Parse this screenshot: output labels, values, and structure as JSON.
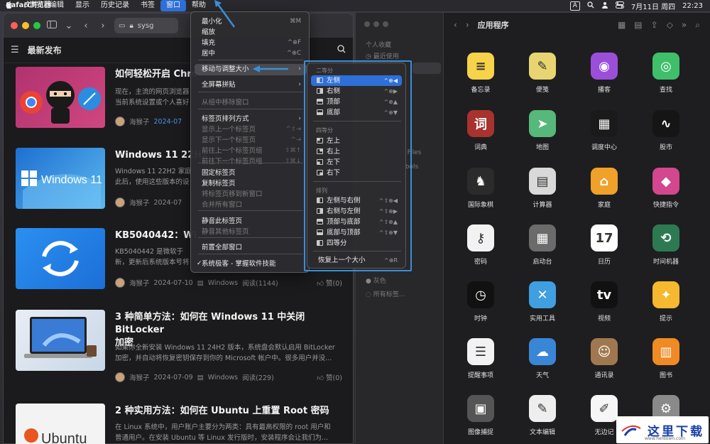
{
  "menubar": {
    "apple": "",
    "app_name": "Safari浏览器",
    "items": [
      "文件",
      "编辑",
      "显示",
      "历史记录",
      "书签",
      "窗口",
      "帮助"
    ],
    "active_index": 5,
    "ime": "A",
    "date": "7月11日 周四",
    "time": "22:23"
  },
  "safari": {
    "url_text": "sysg",
    "site_title": "最新发布",
    "articles": [
      {
        "title": "如何轻松开启 Chro",
        "desc": "现在，主流的网页浏览器\n当前系统设置或个人喜好",
        "author": "海猴子",
        "date": "2024-07",
        "category": "",
        "reads": "",
        "likes": ""
      },
      {
        "title": "Windows 11 22H2",
        "desc": "Windows 11 22H2 家庭\n此后，使用这些版本的设",
        "author": "海猴子",
        "date": "2024-07",
        "category": "",
        "reads": "",
        "likes": ""
      },
      {
        "title": "KB5040442：Wi",
        "desc": "KB5040442 是微软于\n新，更新后系统版本号将",
        "author": "海猴子",
        "date": "2024-07-10",
        "category": "Windows",
        "reads": "阅读(1144)",
        "likes": "赞(0)"
      },
      {
        "title": "3 种简单方法：如何在 Windows 11 中关闭 BitLocker\n加密",
        "desc": "如果你全新安装 Windows 11 24H2 版本，系统盘会默认启用 BitLocker\n加密，并自动将恢复密钥保存到你的 Microsoft 帐户中。很多用户并没...",
        "author": "海猴子",
        "date": "2024-07-09",
        "category": "Windows",
        "reads": "阅读(229)",
        "likes": "赞(0)"
      },
      {
        "title": "2 种实用方法：如何在 Ubuntu 上重置 Root 密码",
        "desc": "在 Linux 系统中，用户账户主要分为两类：具有最高权限的 root 用户和\n普通用户。在安装 Ubuntu 等 Linux 发行版时，安装程序会让我们为...",
        "author": "",
        "date": "",
        "category": "",
        "reads": "",
        "likes": ""
      }
    ],
    "thumb_texts": {
      "win11": "Windows 11",
      "ubuntu": "Ubuntu"
    }
  },
  "sidebar": {
    "section": "个人收藏",
    "recent": "最近使用",
    "files": "d Files",
    "tools": "Tools",
    "gray": "灰色",
    "all_tags": "所有标签..."
  },
  "finder": {
    "title": "应用程序",
    "apps": [
      {
        "label": "备忘录",
        "icon": "notes-icon",
        "color": "#f7d34a",
        "glyph": "≡"
      },
      {
        "label": "便笺",
        "icon": "stickies-icon",
        "color": "#e8d572",
        "glyph": "✎"
      },
      {
        "label": "播客",
        "icon": "podcasts-icon",
        "color": "#9b4fd8",
        "glyph": "◉"
      },
      {
        "label": "查找",
        "icon": "findmy-icon",
        "color": "#3fbf6a",
        "glyph": "◎"
      },
      {
        "label": "词典",
        "icon": "dictionary-icon",
        "color": "#a8322e",
        "glyph": "词"
      },
      {
        "label": "地图",
        "icon": "maps-icon",
        "color": "#56b87a",
        "glyph": "➤"
      },
      {
        "label": "调度中心",
        "icon": "mission-control-icon",
        "color": "#1a1a1a",
        "glyph": "▦"
      },
      {
        "label": "股市",
        "icon": "stocks-icon",
        "color": "#151515",
        "glyph": "∿"
      },
      {
        "label": "国际象棋",
        "icon": "chess-icon",
        "color": "#2b2b2b",
        "glyph": "♞"
      },
      {
        "label": "计算器",
        "icon": "calculator-icon",
        "color": "#d9d9d9",
        "glyph": "▤"
      },
      {
        "label": "家庭",
        "icon": "home-icon",
        "color": "#f0a12a",
        "glyph": "⌂"
      },
      {
        "label": "快捷指令",
        "icon": "shortcuts-icon",
        "color": "#d2478e",
        "glyph": "◆"
      },
      {
        "label": "密码",
        "icon": "passwords-icon",
        "color": "#f2f2f2",
        "glyph": "⚷"
      },
      {
        "label": "启动台",
        "icon": "launchpad-icon",
        "color": "#6b6b6b",
        "glyph": "▦"
      },
      {
        "label": "日历",
        "icon": "calendar-icon",
        "color": "#ffffff",
        "glyph": "17"
      },
      {
        "label": "时间机器",
        "icon": "time-machine-icon",
        "color": "#2d7a52",
        "glyph": "⟲"
      },
      {
        "label": "时钟",
        "icon": "clock-icon",
        "color": "#111111",
        "glyph": "◷"
      },
      {
        "label": "实用工具",
        "icon": "utilities-folder-icon",
        "color": "#3f9fe0",
        "glyph": "✕"
      },
      {
        "label": "视频",
        "icon": "tv-icon",
        "color": "#111111",
        "glyph": "tv"
      },
      {
        "label": "提示",
        "icon": "tips-icon",
        "color": "#f5b82e",
        "glyph": "✦"
      },
      {
        "label": "提醒事项",
        "icon": "reminders-icon",
        "color": "#f2f2f2",
        "glyph": "☰"
      },
      {
        "label": "天气",
        "icon": "weather-icon",
        "color": "#3a86d6",
        "glyph": "☁"
      },
      {
        "label": "通讯录",
        "icon": "contacts-icon",
        "color": "#a07850",
        "glyph": "☺"
      },
      {
        "label": "图书",
        "icon": "books-icon",
        "color": "#f08a24",
        "glyph": "▥"
      },
      {
        "label": "图像捕捉",
        "icon": "image-capture-icon",
        "color": "#555555",
        "glyph": "▣"
      },
      {
        "label": "文本编辑",
        "icon": "textedit-icon",
        "color": "#eeeeee",
        "glyph": "✎"
      },
      {
        "label": "无边记",
        "icon": "freeform-icon",
        "color": "#f6f6f6",
        "glyph": "✐"
      },
      {
        "label": "",
        "icon": "system-settings-icon",
        "color": "#8a8a8a",
        "glyph": "⚙"
      }
    ]
  },
  "window_menu": {
    "items": [
      {
        "label": "最小化",
        "shortcut": "⌘M",
        "disabled": false
      },
      {
        "label": "缩放",
        "shortcut": "",
        "disabled": false
      },
      {
        "label": "填充",
        "shortcut": "^⊕F",
        "disabled": false
      },
      {
        "label": "居中",
        "shortcut": "^⊕C",
        "disabled": false
      },
      {
        "label": "移动与调整大小",
        "shortcut": "",
        "disabled": false,
        "submenu": true
      },
      {
        "label": "全屏幕拼贴",
        "shortcut": "",
        "disabled": false,
        "submenu": true
      },
      {
        "label": "从组中移除窗口",
        "shortcut": "",
        "disabled": true
      },
      {
        "label": "标签页排列方式",
        "shortcut": "",
        "disabled": false,
        "submenu": true
      },
      {
        "label": "显示上一个标签页",
        "shortcut": "^⇧⇥",
        "disabled": true
      },
      {
        "label": "显示下一个标签页",
        "shortcut": "^⇥",
        "disabled": true
      },
      {
        "label": "前往上一个标签页组",
        "shortcut": "⇧⌘↑",
        "disabled": true
      },
      {
        "label": "前往下一个标签页组",
        "shortcut": "⇧⌘↓",
        "disabled": true
      },
      {
        "label": "固定标签页",
        "shortcut": "",
        "disabled": false
      },
      {
        "label": "复制标签页",
        "shortcut": "",
        "disabled": false
      },
      {
        "label": "将标签页移到新窗口",
        "shortcut": "",
        "disabled": true
      },
      {
        "label": "合并所有窗口",
        "shortcut": "",
        "disabled": true
      },
      {
        "label": "静音此标签页",
        "shortcut": "",
        "disabled": false
      },
      {
        "label": "静音其他标签页",
        "shortcut": "",
        "disabled": true
      },
      {
        "label": "前置全部窗口",
        "shortcut": "",
        "disabled": false
      },
      {
        "label": "系统极客 - 掌握软件技能",
        "shortcut": "",
        "disabled": false
      }
    ]
  },
  "submenu": {
    "head_halves": "二等分",
    "head_quarters": "四等分",
    "head_arrange": "排列",
    "halves": [
      {
        "label": "左侧",
        "shortcut": "^⊕◀",
        "selected": true
      },
      {
        "label": "右侧",
        "shortcut": "^⊕▶",
        "selected": false
      },
      {
        "label": "顶部",
        "shortcut": "^⊕▲",
        "selected": false
      },
      {
        "label": "底部",
        "shortcut": "^⊕▼",
        "selected": false
      }
    ],
    "quarters": [
      {
        "label": "左上"
      },
      {
        "label": "右上"
      },
      {
        "label": "左下"
      },
      {
        "label": "右下"
      }
    ],
    "arrange": [
      {
        "label": "左侧与右侧",
        "shortcut": "^⇧⊕◀"
      },
      {
        "label": "右侧与左侧",
        "shortcut": "^⇧⊕▶"
      },
      {
        "label": "顶部与底部",
        "shortcut": "^⇧⊕▲"
      },
      {
        "label": "底部与顶部",
        "shortcut": "^⇧⊕▼"
      },
      {
        "label": "四等分",
        "shortcut": ""
      }
    ],
    "restore": {
      "label": "恢复上一个大小",
      "shortcut": "^⊕R"
    }
  },
  "watermark": {
    "text": "这里下载",
    "url": "www.herdown.com"
  },
  "colors": {
    "accent": "#2e6fd8",
    "highlight": "#3b8fd6"
  }
}
